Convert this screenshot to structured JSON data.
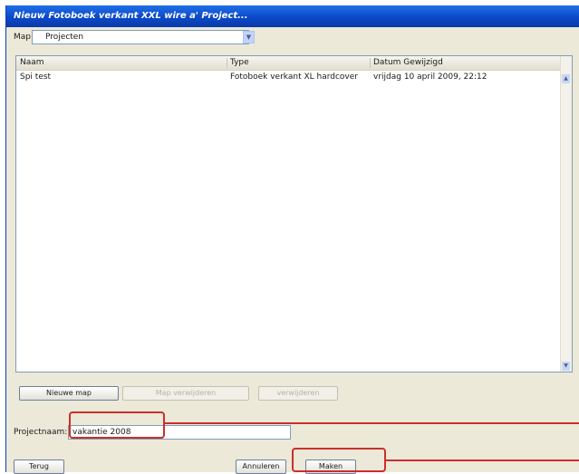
{
  "window": {
    "title": "Nieuw Fotoboek verkant XXL wire a' Project..."
  },
  "folder": {
    "label": "Map:",
    "value": "Projecten"
  },
  "list": {
    "columns": [
      "Naam",
      "Type",
      "Datum Gewijzigd"
    ],
    "rows": [
      {
        "name": "Spi test",
        "type": "Fotoboek verkant XL hardcover",
        "date": "vrijdag 10 april 2009, 22:12"
      }
    ]
  },
  "buttons": {
    "new_folder": "Nieuwe map",
    "rename": "Map verwijderen",
    "delete": "verwijderen",
    "back": "Terug",
    "cancel": "Annuleren",
    "create": "Maken"
  },
  "project": {
    "label": "Projectnaam:",
    "value": "vakantie 2008"
  },
  "colors": {
    "title_bar": "#0c49c8",
    "annotation": "#c9302c"
  }
}
